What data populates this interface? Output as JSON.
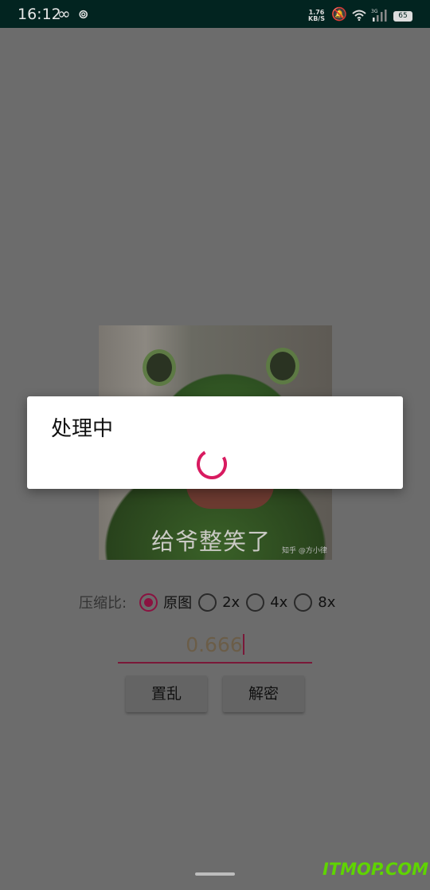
{
  "status_bar": {
    "time": "16:12",
    "speed_value": "1.76",
    "speed_unit": "KB/S",
    "network": "3G",
    "battery": "65",
    "icons": [
      "infinity-icon",
      "netease-music-icon",
      "mute-bell-icon",
      "wifi-icon",
      "signal-icon",
      "battery-icon"
    ]
  },
  "image": {
    "caption": "给爷整笑了",
    "credit": "知乎 @方小律"
  },
  "dialog": {
    "title": "处理中",
    "spinner_color": "#d81b60"
  },
  "ratio": {
    "label": "压缩比:",
    "options": [
      {
        "label": "原图",
        "selected": true
      },
      {
        "label": "2x",
        "selected": false
      },
      {
        "label": "4x",
        "selected": false
      },
      {
        "label": "8x",
        "selected": false
      }
    ]
  },
  "input": {
    "value": "0.666"
  },
  "buttons": {
    "scramble": "置乱",
    "decrypt": "解密"
  },
  "watermark": "ITMOP.COM",
  "colors": {
    "accent": "#d81b60",
    "status_bar": "#022420"
  }
}
